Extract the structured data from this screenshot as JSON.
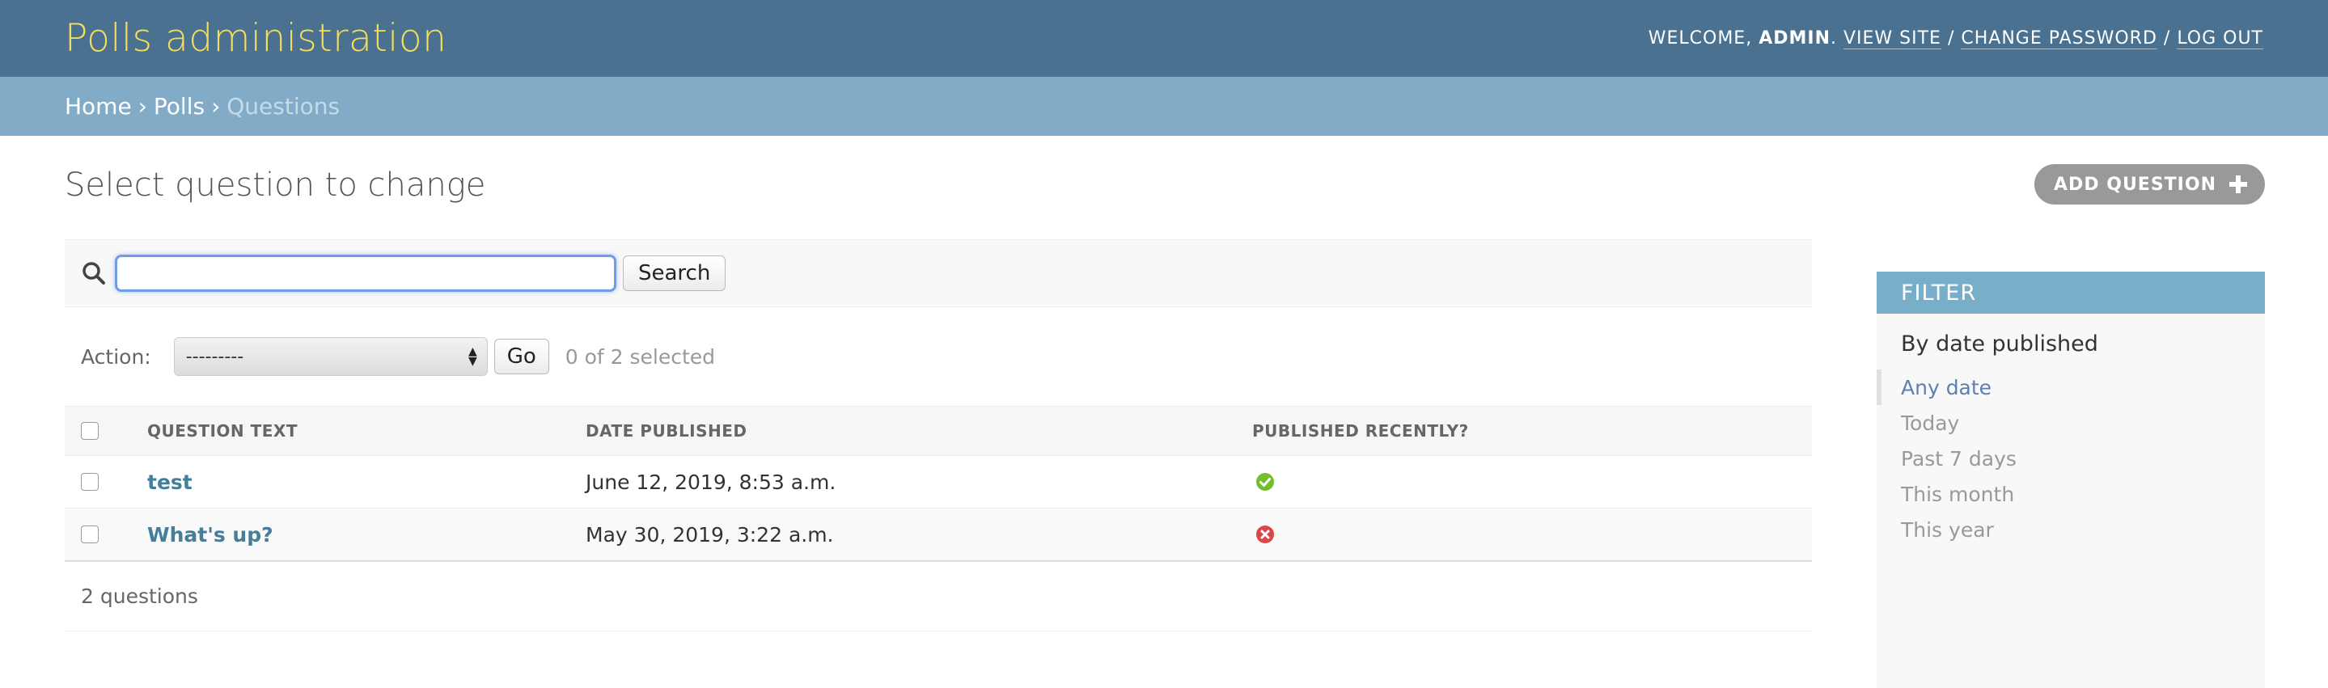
{
  "header": {
    "branding": "Polls administration",
    "welcome_prefix": "Welcome,",
    "username": "admin",
    "view_site": "View site",
    "change_password": "Change password",
    "log_out": "Log out"
  },
  "breadcrumbs": {
    "home": "Home",
    "app": "Polls",
    "current": "Questions",
    "separator": "›"
  },
  "page": {
    "title": "Select question to change",
    "add_button": "Add question"
  },
  "search": {
    "value": "",
    "button": "Search"
  },
  "actions": {
    "label": "Action:",
    "selected_option": "---------",
    "go_button": "Go",
    "counter": "0 of 2 selected"
  },
  "table": {
    "headers": {
      "question_text": "Question text",
      "date_published": "Date published",
      "published_recently": "Published recently?"
    },
    "rows": [
      {
        "question": "test",
        "date": "June 12, 2019, 8:53 a.m.",
        "recent": "yes-icon"
      },
      {
        "question": "What's up?",
        "date": "May 30, 2019, 3:22 a.m.",
        "recent": "no-icon"
      }
    ]
  },
  "paginator": "2 questions",
  "filter": {
    "title": "Filter",
    "heading": "By date published",
    "options": [
      "Any date",
      "Today",
      "Past 7 days",
      "This month",
      "This year"
    ],
    "selected": "Any date"
  },
  "colors": {
    "header_bg": "#4a7290",
    "branding": "#f5dd5d",
    "breadcrumbs_bg": "#82abc7",
    "filter_header_bg": "#79aec8",
    "link": "#447e9b",
    "yes": "#70bf2b",
    "no": "#dd4646"
  }
}
